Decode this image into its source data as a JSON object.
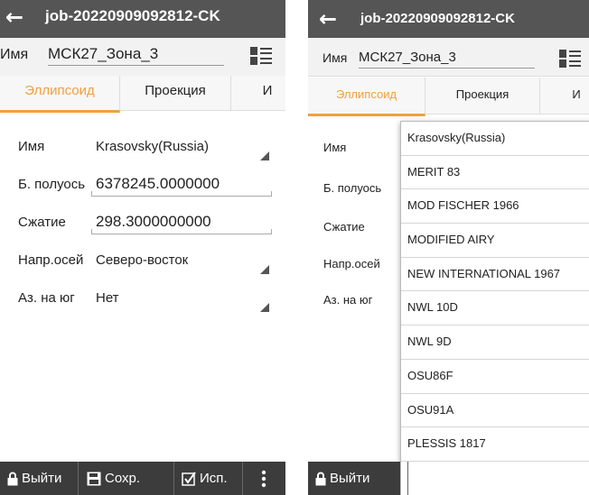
{
  "header": {
    "title": "job-20220909092812-CK"
  },
  "name_bar": {
    "label": "Имя",
    "value": "МСК27_Зона_3"
  },
  "tabs": [
    "Эллипсоид",
    "Проекция",
    "И"
  ],
  "form": {
    "rows": [
      {
        "label": "Имя",
        "value": "Krasovsky(Russia)"
      },
      {
        "label": "Б. полуось",
        "value": "6378245.0000000"
      },
      {
        "label": "Сжатие",
        "value": "298.3000000000"
      },
      {
        "label": "Напр.осей",
        "value": "Северо-восток"
      },
      {
        "label": "Аз. на юг",
        "value": "Нет"
      }
    ]
  },
  "bottom_bar": {
    "exit": "Выйти",
    "save": "Сохр.",
    "use": "Исп."
  },
  "dropdown": {
    "options": [
      "Krasovsky(Russia)",
      "MERIT 83",
      "MOD FISCHER 1966",
      "MODIFIED AIRY",
      "NEW INTERNATIONAL 1967",
      "NWL 10D",
      "NWL 9D",
      "OSU86F",
      "OSU91A",
      "PLESSIS 1817"
    ]
  },
  "colors": {
    "titlebar": "#555555",
    "accent": "#f0a040",
    "bottombar": "#3c3c3c"
  }
}
